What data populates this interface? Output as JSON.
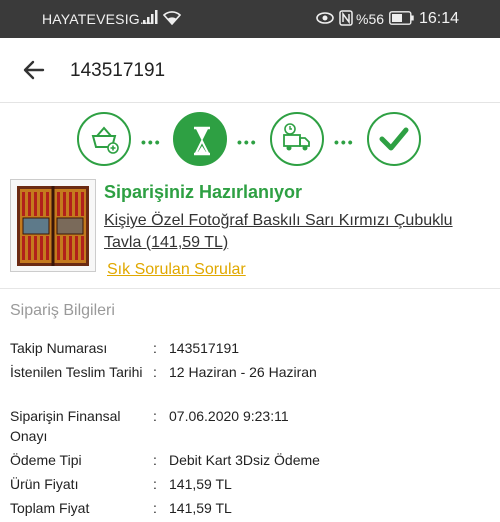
{
  "status_bar": {
    "carrier": "HAYATEVESIG...",
    "battery": "%56",
    "time": "16:14"
  },
  "app_bar": {
    "title": "143517191"
  },
  "stepper": {
    "steps": [
      "basket-check-icon",
      "hourglass-icon",
      "delivery-truck-icon",
      "checkmark-icon"
    ],
    "active_index": 1,
    "accent": "#2ea043"
  },
  "product": {
    "status": "Siparişiniz Hazırlanıyor",
    "name": "Kişiye Özel Fotoğraf Baskılı Sarı Kırmızı Çubuklu Tavla (141,59 TL)",
    "faq_link": "Sık Sorulan Sorular"
  },
  "order_info": {
    "title": "Sipariş Bilgileri",
    "rows": [
      {
        "label": "Takip Numarası",
        "value": "143517191"
      },
      {
        "label": "İstenilen Teslim Tarihi",
        "value": "12 Haziran - 26 Haziran"
      },
      {
        "label": "Siparişin Finansal Onayı",
        "value": "07.06.2020 9:23:11"
      },
      {
        "label": "Ödeme Tipi",
        "value": "Debit Kart 3Dsiz Ödeme"
      },
      {
        "label": "Ürün Fiyatı",
        "value": "141,59 TL"
      },
      {
        "label": "Toplam Fiyat",
        "value": "141,59 TL"
      }
    ]
  }
}
